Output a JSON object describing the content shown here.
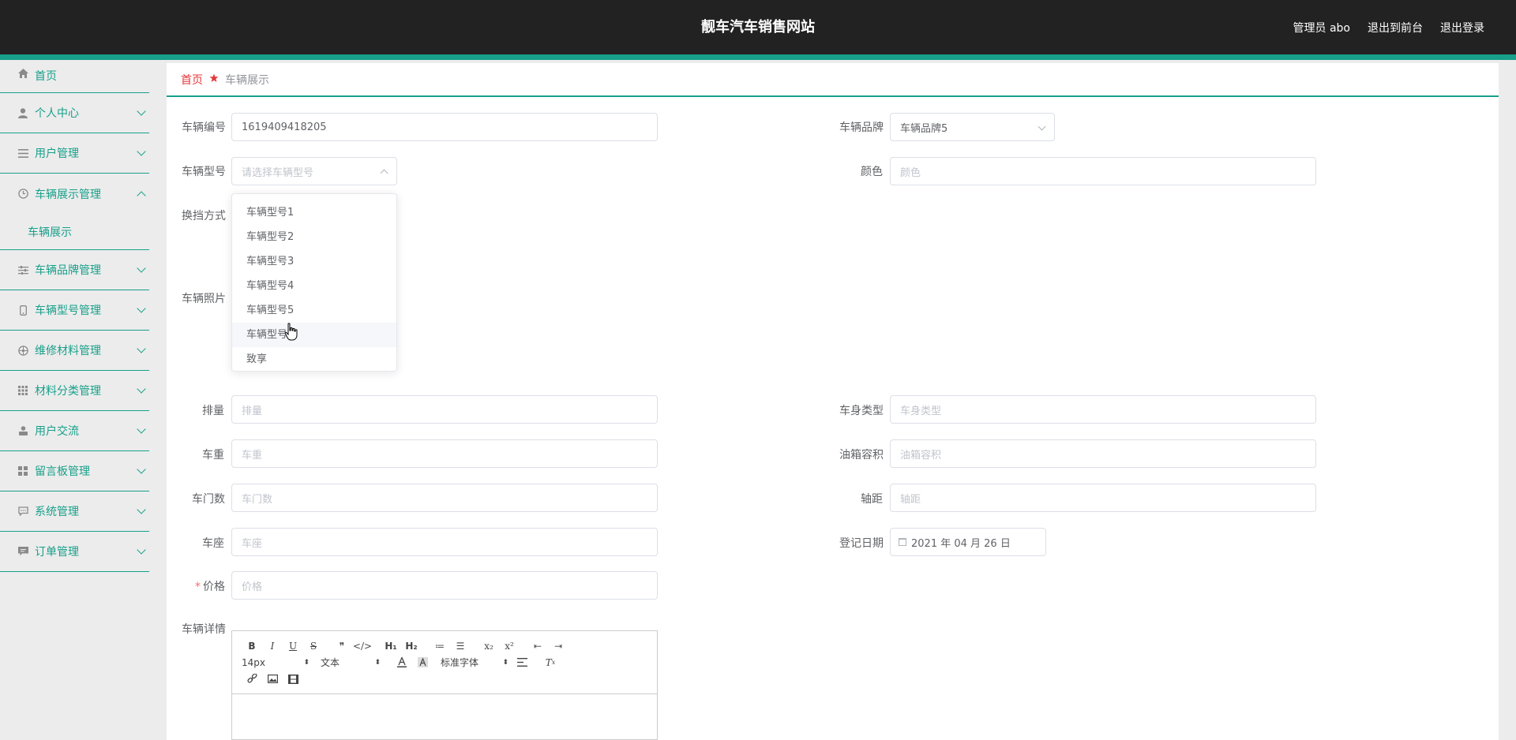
{
  "header": {
    "title": "靓车汽车销售网站",
    "links": [
      "管理员 abo",
      "退出到前台",
      "退出登录"
    ]
  },
  "sidebar": {
    "items": [
      {
        "label": "首页",
        "icon": "home-icon",
        "expandable": false
      },
      {
        "label": "个人中心",
        "icon": "user-icon",
        "expandable": true
      },
      {
        "label": "用户管理",
        "icon": "list-icon",
        "expandable": true
      },
      {
        "label": "车辆展示管理",
        "icon": "clock-icon",
        "expandable": true,
        "expanded": true
      },
      {
        "label": "车辆品牌管理",
        "icon": "sliders-icon",
        "expandable": true
      },
      {
        "label": "车辆型号管理",
        "icon": "phone-icon",
        "expandable": true
      },
      {
        "label": "维修材料管理",
        "icon": "globe-icon",
        "expandable": true
      },
      {
        "label": "材料分类管理",
        "icon": "grid-icon",
        "expandable": true
      },
      {
        "label": "用户交流",
        "icon": "person-icon",
        "expandable": true
      },
      {
        "label": "留言板管理",
        "icon": "apps-icon",
        "expandable": true
      },
      {
        "label": "系统管理",
        "icon": "chat-icon",
        "expandable": true
      },
      {
        "label": "订单管理",
        "icon": "message-icon",
        "expandable": true
      }
    ],
    "submenu": "车辆展示"
  },
  "breadcrumb": {
    "home": "首页",
    "current": "车辆展示"
  },
  "form": {
    "car_number": {
      "label": "车辆编号",
      "value": "1619409418205"
    },
    "brand": {
      "label": "车辆品牌",
      "value": "车辆品牌5"
    },
    "model": {
      "label": "车辆型号",
      "placeholder": "请选择车辆型号"
    },
    "color": {
      "label": "颜色",
      "placeholder": "颜色"
    },
    "transmission": {
      "label": "换挡方式"
    },
    "photo": {
      "label": "车辆照片"
    },
    "displacement": {
      "label": "排量",
      "placeholder": "排量"
    },
    "body_type": {
      "label": "车身类型",
      "placeholder": "车身类型"
    },
    "weight": {
      "label": "车重",
      "placeholder": "车重"
    },
    "tank": {
      "label": "油箱容积",
      "placeholder": "油箱容积"
    },
    "doors": {
      "label": "车门数",
      "placeholder": "车门数"
    },
    "wheelbase": {
      "label": "轴距",
      "placeholder": "轴距"
    },
    "seats": {
      "label": "车座",
      "placeholder": "车座"
    },
    "reg_date": {
      "label": "登记日期",
      "value": "2021 年 04 月 26 日"
    },
    "price": {
      "required": "*",
      "label": "价格",
      "placeholder": "价格"
    },
    "details": {
      "label": "车辆详情"
    }
  },
  "dropdown": {
    "options": [
      "车辆型号1",
      "车辆型号2",
      "车辆型号3",
      "车辆型号4",
      "车辆型号5",
      "车辆型号6",
      "致享"
    ],
    "hovered_index": 5
  },
  "editor": {
    "row1": [
      "B",
      "I",
      "U",
      "S",
      "❞",
      "</>",
      "H₁",
      "H₂",
      "≔",
      "☰",
      "x₂",
      "x²",
      "⇤",
      "⇥"
    ],
    "font_size": "14px",
    "block_type": "文本",
    "font_family": "标准字体",
    "clear_format": "T"
  },
  "colors": {
    "header_bg": "#222222",
    "accent": "#17a08a",
    "breadcrumb_home": "#e4393c"
  }
}
